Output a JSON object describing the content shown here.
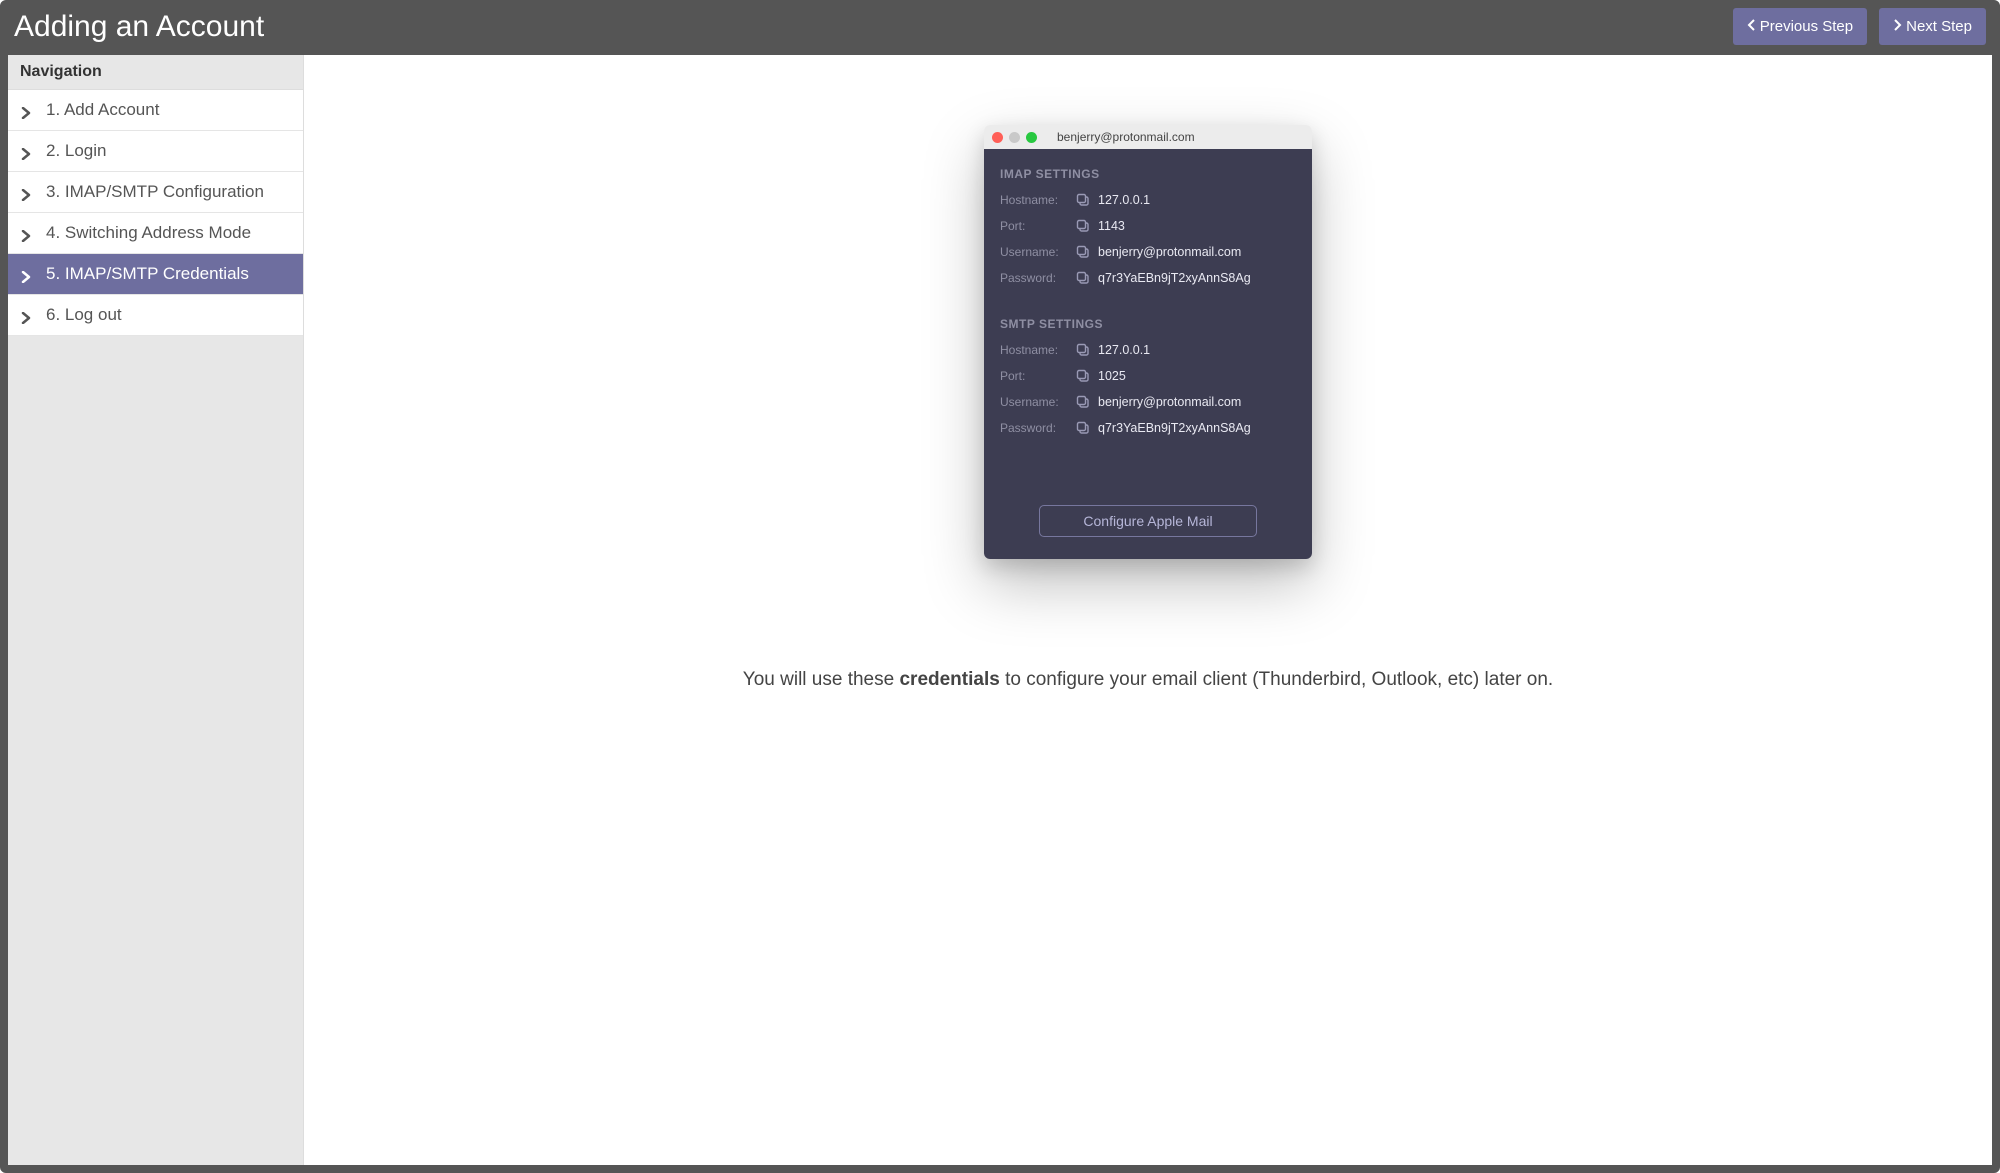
{
  "header": {
    "title": "Adding an Account",
    "prev_label": "Previous Step",
    "next_label": "Next Step"
  },
  "sidebar": {
    "title": "Navigation",
    "items": [
      {
        "label": "1. Add Account"
      },
      {
        "label": "2. Login"
      },
      {
        "label": "3. IMAP/SMTP Configuration"
      },
      {
        "label": "4. Switching Address Mode"
      },
      {
        "label": "5. IMAP/SMTP Credentials"
      },
      {
        "label": "6. Log out"
      }
    ],
    "active_index": 4
  },
  "app": {
    "title": "benjerry@protonmail.com",
    "imap": {
      "heading": "IMAP SETTINGS",
      "hostname_label": "Hostname:",
      "hostname": "127.0.0.1",
      "port_label": "Port:",
      "port": "1143",
      "username_label": "Username:",
      "username": "benjerry@protonmail.com",
      "password_label": "Password:",
      "password": "q7r3YaEBn9jT2xyAnnS8Ag"
    },
    "smtp": {
      "heading": "SMTP SETTINGS",
      "hostname_label": "Hostname:",
      "hostname": "127.0.0.1",
      "port_label": "Port:",
      "port": "1025",
      "username_label": "Username:",
      "username": "benjerry@protonmail.com",
      "password_label": "Password:",
      "password": "q7r3YaEBn9jT2xyAnnS8Ag"
    },
    "configure_label": "Configure Apple Mail"
  },
  "caption": {
    "pre": "You will use these ",
    "bold": "credentials",
    "post": " to configure your email client (Thunderbird, Outlook, etc) later on."
  }
}
